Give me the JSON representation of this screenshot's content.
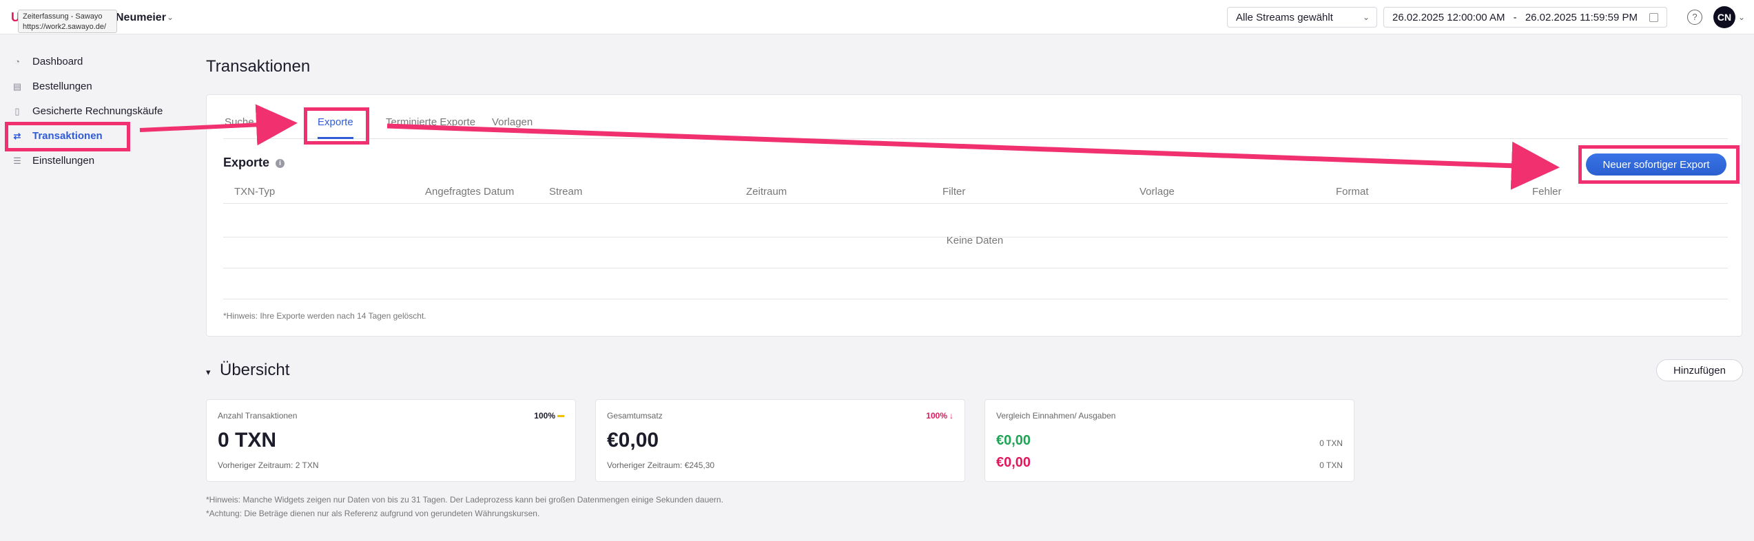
{
  "topbar": {
    "tooltip_title": "Zeiterfassung - Sawayo",
    "tooltip_url": "https://work2.sawayo.de/",
    "account_name": "Neumeier",
    "stream_select": "Alle Streams gewählt",
    "date_from": "26.02.2025  12:00:00 AM",
    "date_sep": "-",
    "date_to": "26.02.2025  11:59:59 PM",
    "help": "?",
    "avatar": "CN"
  },
  "sidebar": {
    "items": [
      {
        "label": "Dashboard",
        "icon": "dashboard-icon"
      },
      {
        "label": "Bestellungen",
        "icon": "orders-icon"
      },
      {
        "label": "Gesicherte Rechnungskäufe",
        "icon": "clipboard-icon"
      },
      {
        "label": "Transaktionen",
        "icon": "transactions-icon"
      },
      {
        "label": "Einstellungen",
        "icon": "settings-icon"
      }
    ],
    "active": "Transaktionen"
  },
  "page": {
    "title": "Transaktionen",
    "tabs": [
      "Suche",
      "Exporte",
      "Terminierte Exporte",
      "Vorlagen"
    ],
    "active_tab": "Exporte",
    "section_title": "Exporte",
    "export_button": "Neuer sofortiger Export",
    "columns": [
      "TXN-Typ",
      "Angefragtes Datum",
      "Stream",
      "Zeitraum",
      "Filter",
      "Vorlage",
      "Format",
      "Fehler"
    ],
    "no_data": "Keine Daten",
    "hint": "*Hinweis: Ihre Exporte werden nach 14 Tagen gelöscht."
  },
  "overview": {
    "title": "Übersicht",
    "add_button": "Hinzufügen",
    "widgets": {
      "txn": {
        "label": "Anzahl Transaktionen",
        "value": "0 TXN",
        "previous": "Vorheriger Zeitraum: 2 TXN",
        "percent": "100%"
      },
      "revenue": {
        "label": "Gesamtumsatz",
        "value": "€0,00",
        "previous": "Vorheriger Zeitraum: €245,30",
        "percent": "100%"
      },
      "compare": {
        "label": "Vergleich Einnahmen/ Ausgaben",
        "income": "€0,00",
        "income_txn": "0 TXN",
        "expense": "€0,00",
        "expense_txn": "0 TXN"
      }
    },
    "footnote_1": "*Hinweis: Manche Widgets zeigen nur Daten von bis zu 31 Tagen. Der Ladeprozess kann bei großen Datenmengen einige Sekunden dauern.",
    "footnote_2": "*Achtung: Die Beträge dienen nur als Referenz aufgrund von gerundeten Währungskursen."
  },
  "colors": {
    "accent": "#2f5bd6",
    "highlight": "#f0306f",
    "positive": "#1fa355",
    "negative": "#e0195b"
  }
}
